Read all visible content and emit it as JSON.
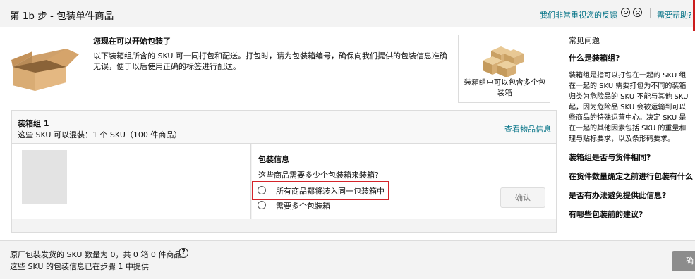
{
  "header": {
    "title": "第 1b 步 - 包装单件商品",
    "feedback_link": "我们非常重视您的反馈",
    "help_link": "需要帮助?"
  },
  "intro": {
    "title": "您现在可以开始包装了",
    "text": "以下装箱组所含的 SKU 可一同打包和配送。打包时，请为包装箱编号，确保向我们提供的包装信息准确无误，便于以后使用正确的标签进行配送。",
    "image_caption": "装箱组中可以包含多个包装箱"
  },
  "faq": {
    "title": "常见问题",
    "q1": "什么是装箱组?",
    "answer_lines": [
      "装箱组是指可以打包在一起的 SKU 组",
      "在一起的 SKU 需要打包为不同的装箱",
      "归类为危险品的 SKU 不能与其他 SKU",
      "起，因为危险品 SKU 会被运输到可以",
      "些商品的特殊运营中心。决定 SKU 是",
      "在一起的其他因素包括 SKU 的重量和",
      "理与贴标要求，以及条形码要求。"
    ],
    "q2": "装箱组是否与货件相同?",
    "q3": "在货件数量确定之前进行包装有什么",
    "q4": "是否有办法避免提供此信息?",
    "q5": "有哪些包装前的建议?"
  },
  "group": {
    "name": "装箱组 1",
    "summary": "这些 SKU 可以混装：1 个 SKU（100 件商品）",
    "view_link": "查看物品信息",
    "packing_title": "包装信息",
    "question": "这些商品需要多少个包装箱来装箱?",
    "option_single": "所有商品都将装入同一包装箱中",
    "option_multi": "需要多个包装箱",
    "confirm": "确认"
  },
  "footer": {
    "line1": "原厂包装发货的 SKU 数量为 0，共 0 箱 0 件商品",
    "help_mark": "?",
    "line2": "这些 SKU 的包装信息已在步骤 1 中提供",
    "confirm_cut": "确"
  }
}
